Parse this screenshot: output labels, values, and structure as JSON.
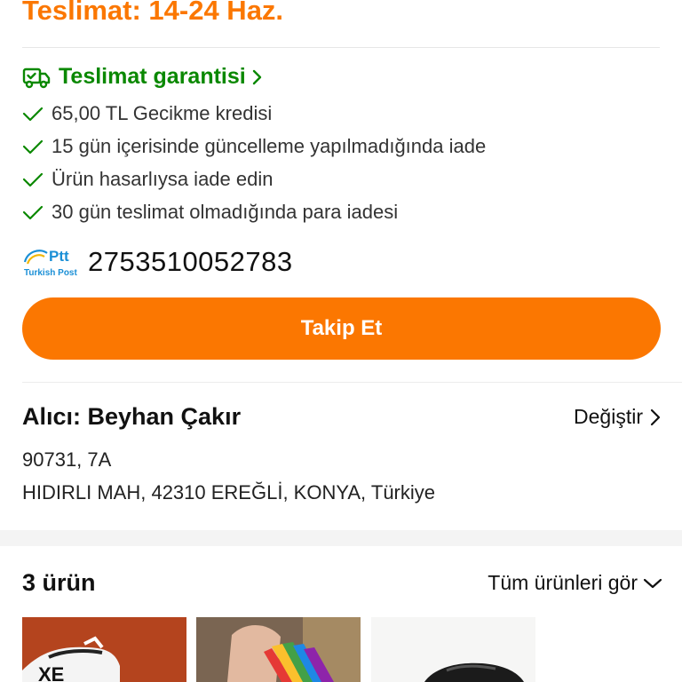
{
  "delivery": {
    "date_text": "Teslimat: 14-24 Haz."
  },
  "guarantee": {
    "title": "Teslimat garantisi",
    "items": [
      "65,00 TL Gecikme kredisi",
      "15 gün içerisinde güncelleme yapılmadığında iade",
      "Ürün hasarlıysa iade edin",
      "30 gün teslimat olmadığında para iadesi"
    ]
  },
  "shipping": {
    "carrier_logo_text": "Ptt",
    "carrier_logo_subtext": "Turkish Post",
    "tracking_number": "2753510052783",
    "follow_button": "Takip Et"
  },
  "address": {
    "recipient_label": "Alıcı: Beyhan Çakır",
    "change_label": "Değiştir",
    "line1": "90731, 7A",
    "line2": "HIDIRLI MAH, 42310 EREĞLİ, KONYA, Türkiye"
  },
  "products": {
    "count_label": "3 ürün",
    "view_all_label": "Tüm ürünleri gör",
    "thumb1_text": "XE"
  },
  "colors": {
    "accent": "#fb7701",
    "guarantee_green": "#0a8800",
    "ptt_blue": "#1a8fd6"
  }
}
